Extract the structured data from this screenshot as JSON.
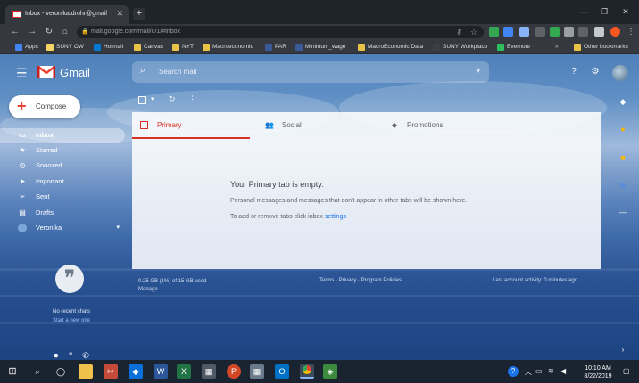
{
  "browser": {
    "tab_title": "Inbox - veronika.drohr@gmail",
    "url": "mail.google.com/mail/u/1/#inbox",
    "window_controls": [
      "—",
      "❐",
      "✕"
    ]
  },
  "bookmarks": [
    {
      "label": "Apps"
    },
    {
      "label": "SUNY OW"
    },
    {
      "label": "Hotmail"
    },
    {
      "label": "Canvas"
    },
    {
      "label": "NYT"
    },
    {
      "label": "Macroeconomic"
    },
    {
      "label": "PAR"
    },
    {
      "label": "Minimum_wage"
    },
    {
      "label": "MacroEconomic Data"
    },
    {
      "label": "SUNY Workplace"
    },
    {
      "label": "Evernote"
    },
    {
      "label": "Other bookmarks"
    }
  ],
  "gmail": {
    "logo_text": "Gmail",
    "search_placeholder": "Search mail",
    "compose_label": "Compose",
    "nav": [
      {
        "label": "Inbox",
        "icon": "inbox-icon"
      },
      {
        "label": "Starred",
        "icon": "star-icon"
      },
      {
        "label": "Snoozed",
        "icon": "clock-icon"
      },
      {
        "label": "Important",
        "icon": "important-icon"
      },
      {
        "label": "Sent",
        "icon": "send-icon"
      },
      {
        "label": "Drafts",
        "icon": "draft-icon"
      },
      {
        "label": "Veronika",
        "icon": "user-icon"
      }
    ],
    "hangouts": {
      "line1": "No recent chats",
      "line2": "Start a new one"
    },
    "tabs": [
      {
        "label": "Primary"
      },
      {
        "label": "Social"
      },
      {
        "label": "Promotions"
      }
    ],
    "empty": {
      "title": "Your Primary tab is empty.",
      "desc": "Personal messages and messages that don't appear in other tabs will be shown here.",
      "settings_prefix": "To add or remove tabs click inbox",
      "settings_link": "settings"
    },
    "footer": {
      "storage": "0.25 GB (1%) of 15 GB used",
      "manage": "Manage",
      "terms": "Terms · Privacy · Program Policies",
      "activity": "Last account activity: 0 minutes ago"
    }
  },
  "taskbar": {
    "time": "10:10 AM",
    "date": "8/22/2019"
  },
  "colors": {
    "accent_red": "#d93025",
    "link_blue": "#1a73e8"
  }
}
